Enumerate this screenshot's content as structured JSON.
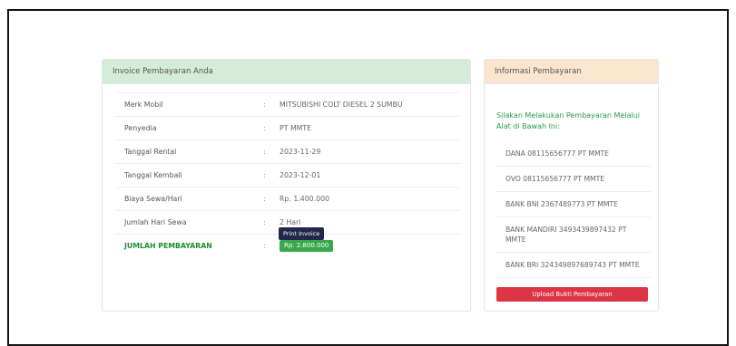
{
  "invoice": {
    "title": "Invoice Pembayaran Anda",
    "separator": ":",
    "rows": [
      {
        "label": "Merk Mobil",
        "value": "MITSUBISHI COLT DIESEL 2 SUMBU"
      },
      {
        "label": "Penyedia",
        "value": "PT MMTE"
      },
      {
        "label": "Tanggal Rental",
        "value": "2023-11-29"
      },
      {
        "label": "Tanggal Kembali",
        "value": "2023-12-01"
      },
      {
        "label": "Biaya Sewa/Hari",
        "value": "Rp. 1.400.000"
      },
      {
        "label": "Jumlah Hari Sewa",
        "value": "2 Hari"
      }
    ],
    "total": {
      "label": "JUMLAH PEMBAYARAN",
      "value": "Rp. 2.800.000"
    },
    "print_label": "Print Invoice"
  },
  "payment_info": {
    "title": "Informasi Pembayaran",
    "instruction": "Silakan Melakukan Pembayaran Melalui Alat di Bawah Ini:",
    "methods": [
      "DANA 08115656777 PT MMTE",
      "OVO 08115656777 PT MMTE",
      "BANK BNI 2367489773 PT MMTE",
      "BANK MANDIRI 3493439897432 PT MMTE",
      "BANK BRI 324349897689743 PT MMTE"
    ],
    "upload_label": "Upload Bukti Pembayaran"
  },
  "colors": {
    "header_green": "#d4ecd8",
    "header_orange": "#fce5cf",
    "total_green": "#1e8e2f",
    "badge_green": "#38a84a",
    "print_button": "#21294a",
    "upload_button": "#dc3545"
  }
}
